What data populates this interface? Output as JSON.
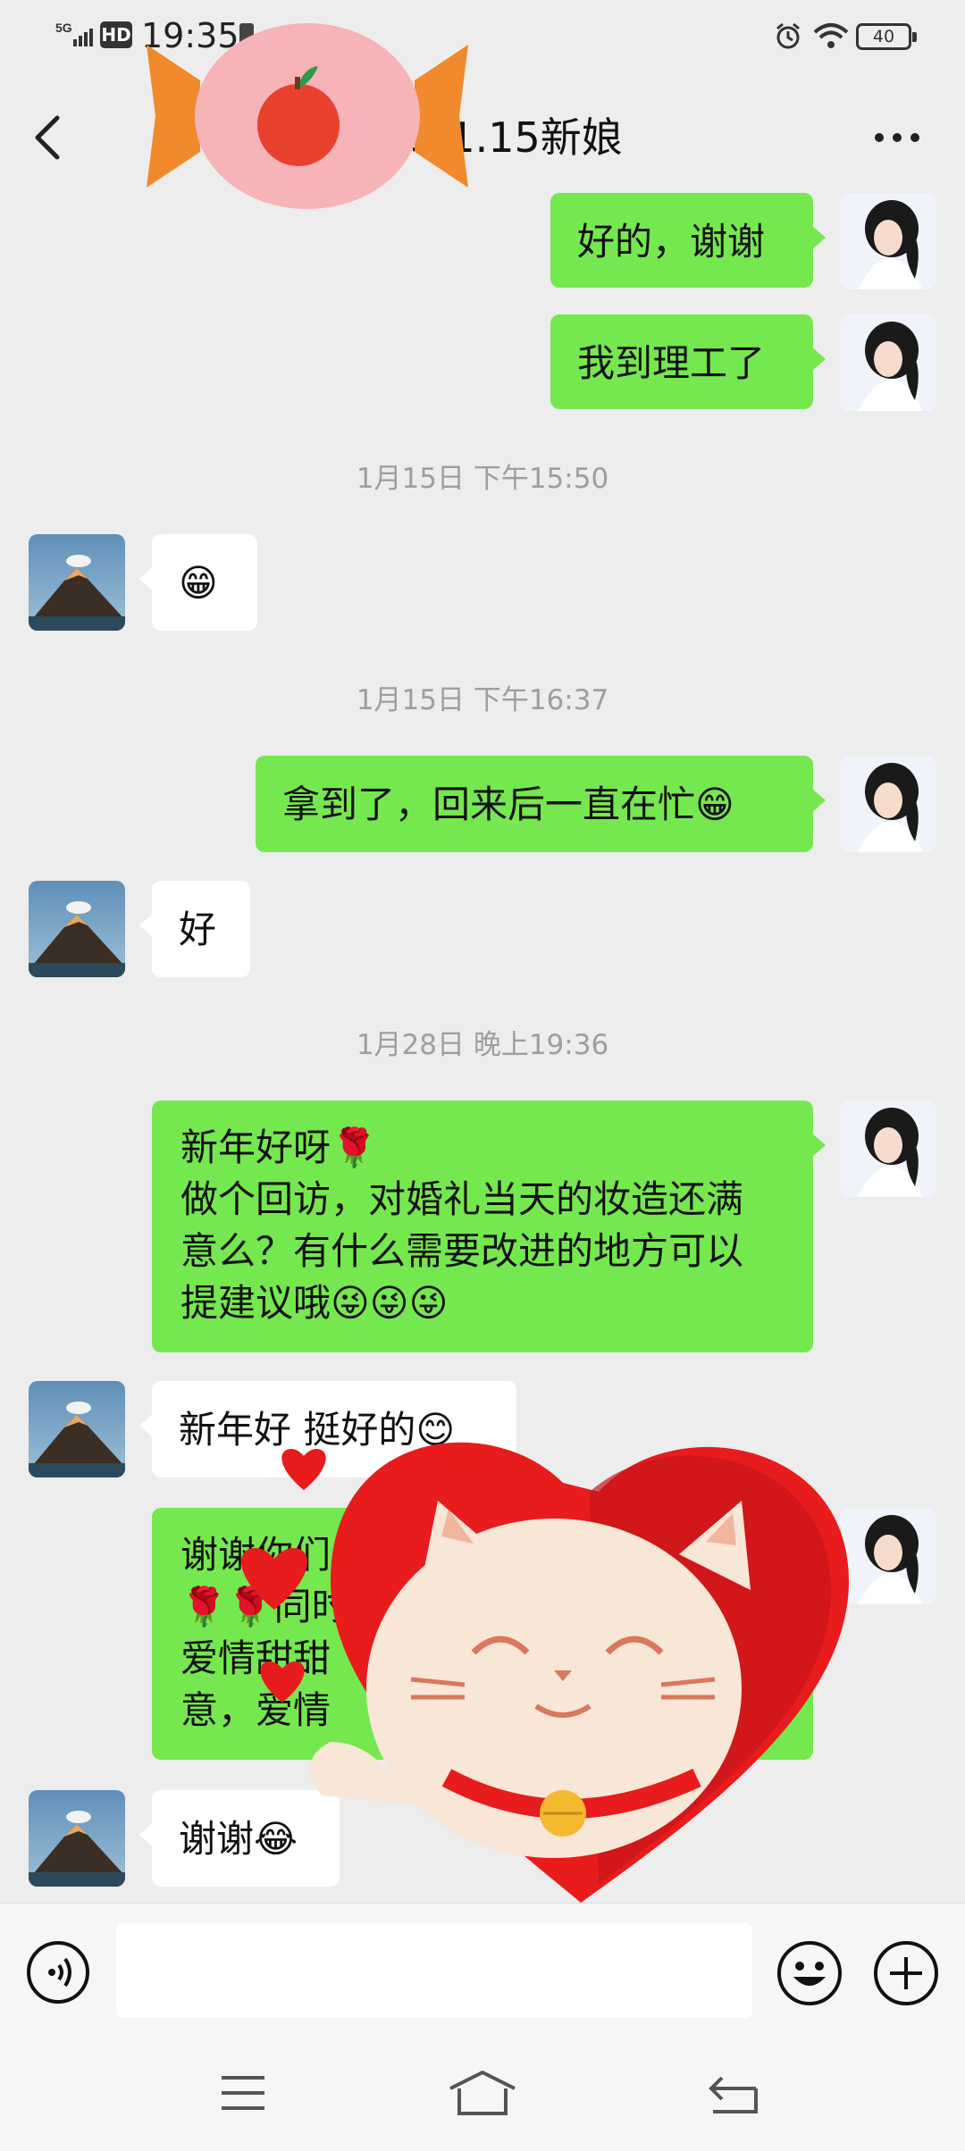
{
  "status_bar": {
    "network": "5G",
    "hd": "HD",
    "time": "19:35",
    "battery": "40"
  },
  "header": {
    "title": "林23.1.15新娘"
  },
  "messages": [
    {
      "type": "me",
      "text": "好的，谢谢"
    },
    {
      "type": "me",
      "text": "我到理工了"
    },
    {
      "type": "time",
      "text": "1月15日 下午15:50"
    },
    {
      "type": "them",
      "text": "😁"
    },
    {
      "type": "time",
      "text": "1月15日 下午16:37"
    },
    {
      "type": "me",
      "text": "拿到了，回来后一直在忙😁"
    },
    {
      "type": "them",
      "text": "好"
    },
    {
      "type": "time",
      "text": "1月28日 晚上19:36"
    },
    {
      "type": "me",
      "text": "新年好呀🌹\n做个回访，对婚礼当天的妆造还满\n意么？有什么需要改进的地方可以\n提建议哦😜😜😜"
    },
    {
      "type": "them",
      "text": "新年好 挺好的😊"
    },
    {
      "type": "me",
      "text": "谢谢你们\n🌹🌹同时\n爱情甜甜\n意，爱情"
    },
    {
      "type": "them",
      "text": "谢谢😂"
    }
  ],
  "input": {
    "placeholder": ""
  },
  "icons": {
    "back": "back-arrow-icon",
    "more": "more-dots-icon",
    "voice": "voice-icon",
    "emoji": "emoji-icon",
    "plus": "plus-icon",
    "nav_menu": "menu-icon",
    "nav_home": "home-icon",
    "nav_back": "back-nav-icon"
  },
  "colors": {
    "background": "#ededed",
    "my_bubble": "#75e84f",
    "their_bubble": "#ffffff"
  }
}
